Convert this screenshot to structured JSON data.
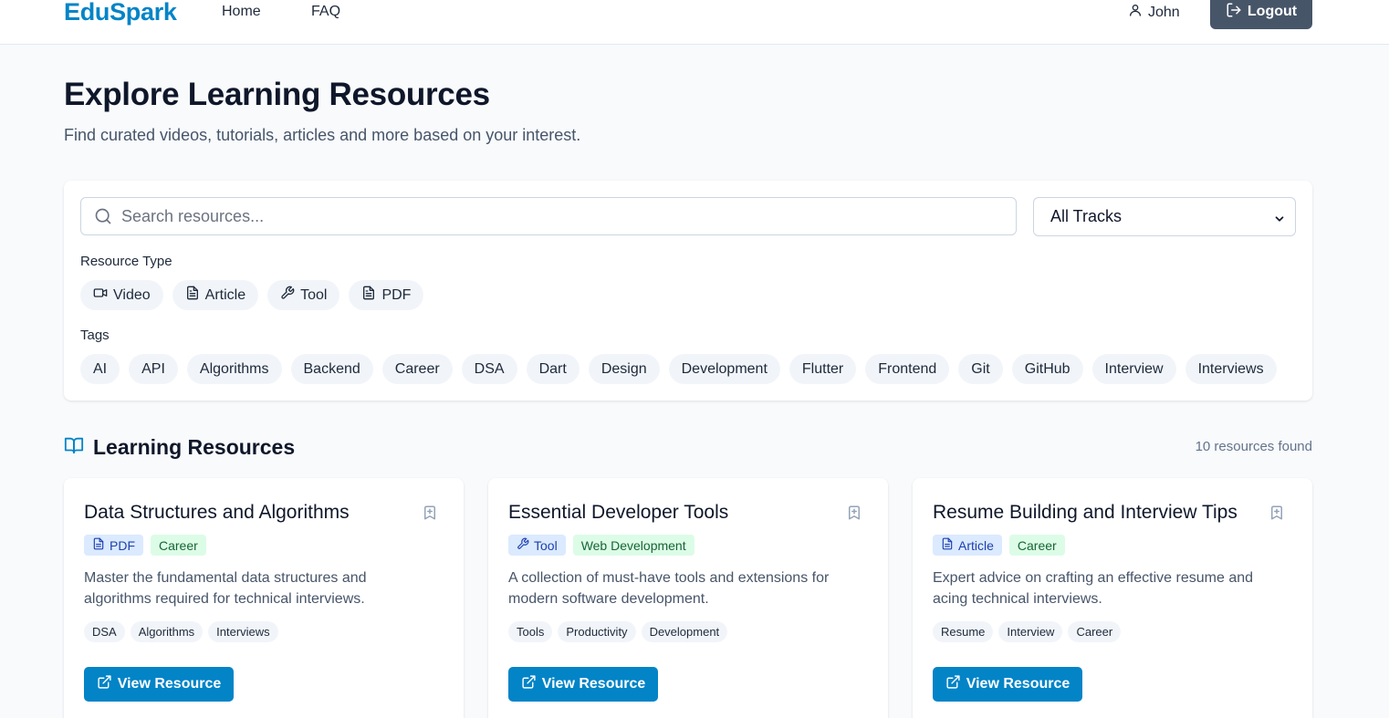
{
  "nav": {
    "brand": "EduSpark",
    "links": [
      "Home",
      "FAQ"
    ],
    "user": "John",
    "logout_label": "Logout"
  },
  "header": {
    "title": "Explore Learning Resources",
    "subtitle": "Find curated videos, tutorials, articles and more based on your interest."
  },
  "filters": {
    "search_placeholder": "Search resources...",
    "search_value": "",
    "track_selected": "All Tracks",
    "resource_type_label": "Resource Type",
    "resource_types": [
      {
        "label": "Video",
        "icon": "video-icon"
      },
      {
        "label": "Article",
        "icon": "file-text-icon"
      },
      {
        "label": "Tool",
        "icon": "wrench-icon"
      },
      {
        "label": "PDF",
        "icon": "file-text-icon"
      }
    ],
    "tags_label": "Tags",
    "tags": [
      "AI",
      "API",
      "Algorithms",
      "Backend",
      "Career",
      "DSA",
      "Dart",
      "Design",
      "Development",
      "Flutter",
      "Frontend",
      "Git",
      "GitHub",
      "Interview",
      "Interviews"
    ]
  },
  "resources": {
    "title": "Learning Resources",
    "count_text": "10 resources found",
    "cards": [
      {
        "title": "Data Structures and Algorithms",
        "type": "PDF",
        "type_icon": "file-text-icon",
        "track": "Career",
        "description": "Master the fundamental data structures and algorithms required for technical interviews.",
        "tags": [
          "DSA",
          "Algorithms",
          "Interviews"
        ],
        "button_label": "View Resource"
      },
      {
        "title": "Essential Developer Tools",
        "type": "Tool",
        "type_icon": "wrench-icon",
        "track": "Web Development",
        "description": "A collection of must-have tools and extensions for modern software development.",
        "tags": [
          "Tools",
          "Productivity",
          "Development"
        ],
        "button_label": "View Resource"
      },
      {
        "title": "Resume Building and Interview Tips",
        "type": "Article",
        "type_icon": "file-text-icon",
        "track": "Career",
        "description": "Expert advice on crafting an effective resume and acing technical interviews.",
        "tags": [
          "Resume",
          "Interview",
          "Career"
        ],
        "button_label": "View Resource"
      }
    ]
  },
  "colors": {
    "brand": "#0284c7",
    "logout_bg": "#475569",
    "type_badge_bg": "#dbeafe",
    "track_badge_bg": "#dcfce7"
  }
}
